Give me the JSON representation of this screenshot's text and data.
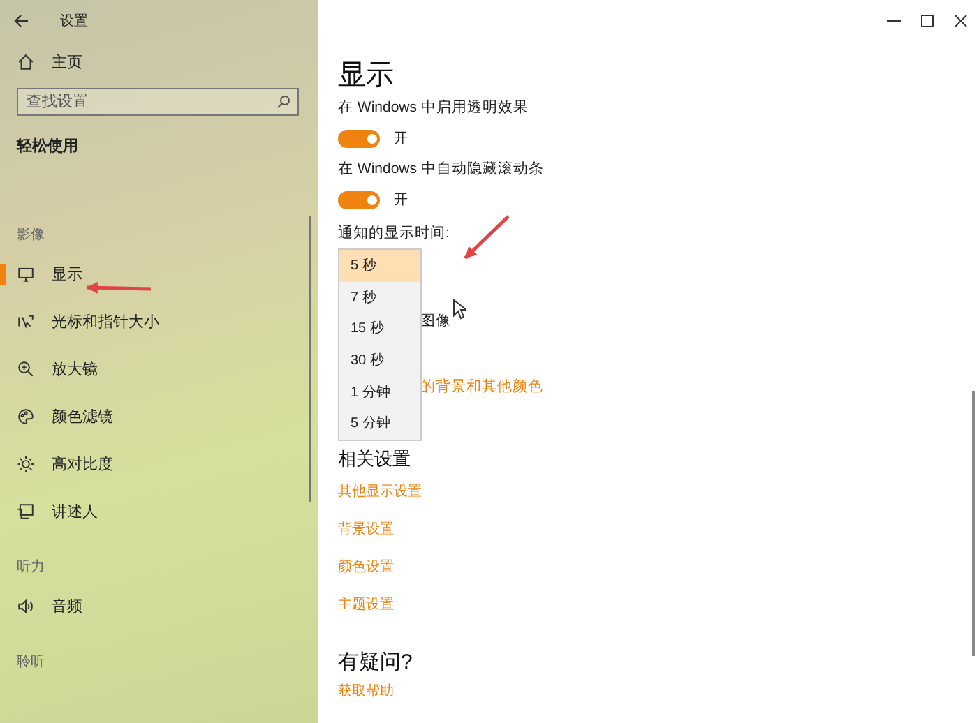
{
  "window": {
    "title": "设置"
  },
  "sidebar": {
    "home": "主页",
    "search": {
      "placeholder": "查找设置"
    },
    "category": "轻松使用",
    "sections": [
      {
        "heading": "影像",
        "items": [
          {
            "label": "显示",
            "selected": true
          },
          {
            "label": "光标和指针大小",
            "selected": false
          },
          {
            "label": "放大镜",
            "selected": false
          },
          {
            "label": "颜色滤镜",
            "selected": false
          },
          {
            "label": "高对比度",
            "selected": false
          },
          {
            "label": "讲述人",
            "selected": false
          }
        ]
      },
      {
        "heading": "听力",
        "items": [
          {
            "label": "音频",
            "selected": false
          }
        ]
      },
      {
        "heading": "聆听"
      }
    ]
  },
  "content": {
    "title": "显示",
    "toggles": [
      {
        "label": "在 Windows 中启用透明效果",
        "on": true,
        "state_text": "开"
      },
      {
        "label": "在 Windows 中自动隐藏滚动条",
        "on": true,
        "state_text": "开"
      }
    ],
    "notification": {
      "label": "通知的显示时间:",
      "dropdown": {
        "expanded": true,
        "options": [
          {
            "label": "5 秒",
            "selected": true
          },
          {
            "label": "7 秒",
            "selected": false
          },
          {
            "label": "15 秒",
            "selected": false
          },
          {
            "label": "30 秒",
            "selected": false
          },
          {
            "label": "1 分钟",
            "selected": false
          },
          {
            "label": "5 分钟",
            "selected": false
          }
        ]
      }
    },
    "covered_text": "图像",
    "covered_link": "的背景和其他颜色",
    "related": {
      "heading": "相关设置",
      "links": [
        "其他显示设置",
        "背景设置",
        "颜色设置",
        "主题设置"
      ]
    },
    "help": {
      "heading": "有疑问?",
      "link": "获取帮助"
    }
  }
}
